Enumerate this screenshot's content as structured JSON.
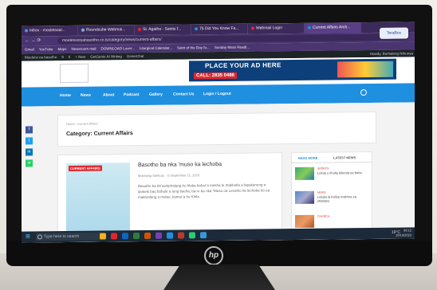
{
  "browser": {
    "tabs": [
      {
        "label": "Inbox - mosletsoal...",
        "color": "#4a90e2"
      },
      {
        "label": "Roundcube Webmai...",
        "color": "#6fb3e6"
      },
      {
        "label": "St. Agatha - Saints f...",
        "color": "#e1262b"
      },
      {
        "label": "75 Did You Know Fa...",
        "color": "#1f8fe0"
      },
      {
        "label": "Webmail Login",
        "color": "#e1262b"
      },
      {
        "label": "Current Affairs Arch...",
        "color": "#1f8fe0",
        "active": true
      }
    ],
    "url": "moeletsiotsabasotho.co.ls/category/news/current-affairs/",
    "terabox": "TeraBox",
    "bookmarks": [
      "Gmail",
      "YouTube",
      "Maps",
      "Newsroom mail",
      "DOWNLOAD Lover...",
      "Liturgical Calendar...",
      "Saint of the Day fo...",
      "Sunday Mass Readi..."
    ]
  },
  "wp_admin": {
    "items": [
      "Moeletsi oa basotho",
      "9",
      "0",
      "+ New",
      "GetGenie AI Writing",
      "GenieChat"
    ],
    "howdy": "Howdy, Bumaleng Nthunya"
  },
  "banner": {
    "ad_headline": "PLACE YOUR AD HERE",
    "ad_phone": "CALL: 2835 0486"
  },
  "nav": [
    "Home",
    "News",
    "About",
    "Podcast",
    "Gallery",
    "Contact Us",
    "Login / Logout"
  ],
  "breadcrumb": "Home  ›  Current Affairs",
  "category_title": "Category: Current Affairs",
  "post": {
    "badge": "CURRENT AFFAIRS",
    "title": "Basotho ba nka ‘muso ka lechoba",
    "author": "Moletsing Sekhutu",
    "date": "September 21, 2023",
    "excerpt": "Basotho ba bit’sumphalang ho hlaka  bahar’a mekha le makhotla a   fapakaneng a ipokeki bao  bohole  a teng bacha, ba re ba nka  “Muso oa Lesotho ka lechoba ho ea makhotleng a molao, kamor’a ho Khila"
  },
  "sidebar": {
    "tab1": "READ MORE",
    "tab2": "LATEST NEWS",
    "items": [
      {
        "cat": "SPORTS",
        "text": "Lefola o ithulla lebenta ea bana"
      },
      {
        "cat": "NEWS",
        "text": "Lekala la Kolisa makhoa ea ntlafatso"
      },
      {
        "cat": "CHURCH",
        "text": ""
      }
    ]
  },
  "taskbar": {
    "search_placeholder": "Type here to search",
    "temp": "19°C",
    "time": "09:12",
    "date": "10/10/2023"
  },
  "brand": "hp"
}
